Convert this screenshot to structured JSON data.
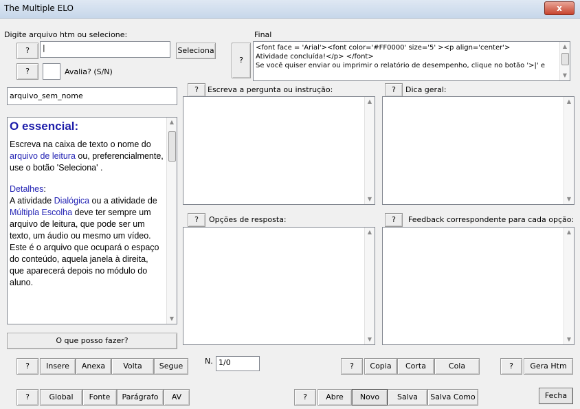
{
  "window": {
    "title": "The Multiple ELO",
    "close": "x"
  },
  "file": {
    "label": "Digite arquivo htm ou selecione:",
    "help": "?",
    "value": "|",
    "select_button": "Seleciona",
    "evaluate_help": "?",
    "evaluate_label": "Avalia? (S/N)",
    "evaluate_value": "",
    "filename": "arquivo_sem_nome"
  },
  "final": {
    "label": "Final",
    "help": "?",
    "lines": [
      "<font face = 'Arial'><font color='#FF0000' size='5' ><p align='center'>",
      "Atividade concluída!</p> </font>",
      "Se você quiser enviar ou imprimir o relatório de desempenho, clique no botão '>|' e"
    ]
  },
  "help_panel": {
    "heading": "O essencial:",
    "p1_a": "Escreva na caixa de texto o nome do ",
    "p1_link": "arquivo de leitura",
    "p1_b": " ou, preferencialmente, use o botão 'Seleciona' .",
    "details_heading": "Detalhes",
    "details_colon": ":",
    "p2_a": " A atividade ",
    "p2_link1": "Dialógica",
    "p2_b": " ou a atividade de ",
    "p2_link2": "Múltipla Escolha",
    "p2_c": " deve ter sempre um arquivo de leitura, que pode ser um texto, um áudio ou mesmo um vídeo.  Este é o arquivo que ocupará o espaço do conteúdo, aquela janela à direita, que aparecerá depois no módulo do aluno.",
    "what_button": "O que posso fazer?"
  },
  "fields": {
    "question_label": "Escreva a pergunta ou instrução:",
    "hint_label": "Dica geral:",
    "options_label": "Opções de resposta:",
    "feedback_label": "Feedback correspondente para cada opção:",
    "help": "?"
  },
  "nav": {
    "help": "?",
    "insert": "Insere",
    "attach": "Anexa",
    "back": "Volta",
    "next": "Segue",
    "n_label": "N.",
    "n_value": "1/0"
  },
  "edit": {
    "help": "?",
    "copy": "Copia",
    "cut": "Corta",
    "paste": "Cola"
  },
  "generate": {
    "help": "?",
    "label": "Gera Htm"
  },
  "format": {
    "help": "?",
    "global": "Global",
    "font": "Fonte",
    "paragraph": "Parágrafo",
    "av": "AV"
  },
  "filebar": {
    "help": "?",
    "open": "Abre",
    "new": "Novo",
    "save": "Salva",
    "save_as": "Salva Como"
  },
  "close_button": "Fecha"
}
